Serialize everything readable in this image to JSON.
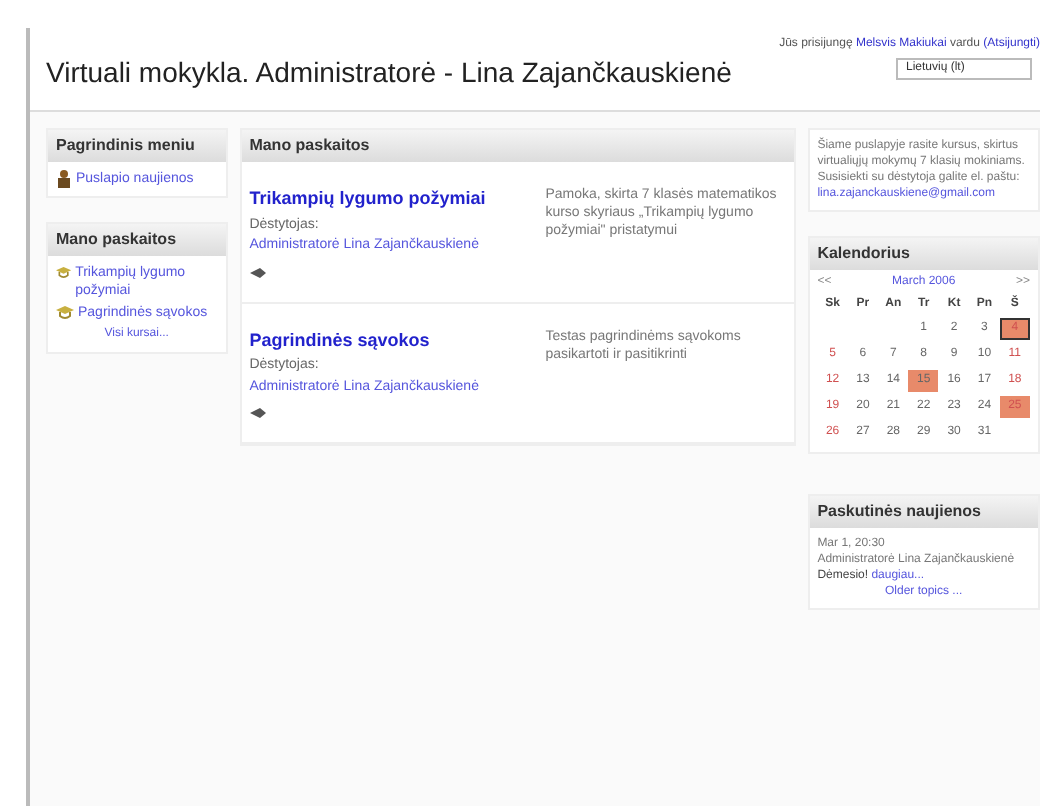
{
  "header": {
    "title": "Virtuali mokykla. Administratorė - Lina Zajančkauskienė",
    "login_prefix": "Jūs prisijungę",
    "login_user": "Melsvis Makiukai",
    "login_suffix": "vardu",
    "login_link": "(Atsijungti)",
    "language": "Lietuvių (lt)"
  },
  "left_blocks": [
    {
      "title": "Pagrindinis meniu",
      "items": [
        {
          "kind": "news",
          "label": "Puslapio naujienos"
        }
      ]
    },
    {
      "title": "Mano paskaitos",
      "items": [
        {
          "kind": "course",
          "label": "Trikampių lygumo požymiai"
        },
        {
          "kind": "course",
          "label": "Pagrindinės sąvokos"
        }
      ],
      "footer": "Visi kursai..."
    }
  ],
  "courses": {
    "title": "Mano paskaitos",
    "items": [
      {
        "name": "Trikampių lygumo požymiai",
        "teacher_label": "Dėstytojas:",
        "teacher": "Administratorė Lina Zajančkauskienė",
        "description": "Pamoka, skirta 7 klasės matematikos kurso skyriaus „Trikampių lygumo požymiai\" pristatymui"
      },
      {
        "name": "Pagrindinės sąvokos",
        "teacher_label": "Dėstytojas:",
        "teacher": "Administratorė Lina Zajančkauskienė",
        "description": "Testas pagrindinėms sąvokoms pasikartoti ir pasitikrinti"
      }
    ]
  },
  "info": {
    "text": "Šiame puslapyje rasite kursus, skirtus virtualiųjų mokymų 7 klasių mokiniams. Susisiekti su dėstytoja galite el. paštu:",
    "email": "lina.zajanckauskiene@gmail.com"
  },
  "calendar": {
    "title": "Kalendorius",
    "prev": "<<",
    "month": "March 2006",
    "next": ">>",
    "weekdays": [
      "Sk",
      "Pr",
      "An",
      "Tr",
      "Kt",
      "Pn",
      "Š"
    ],
    "weeks": [
      [
        {
          "day": "1",
          "event": false,
          "today": false
        },
        {
          "day": "2",
          "event": false,
          "today": false
        },
        {
          "day": "3",
          "event": false,
          "today": false
        },
        {
          "day": "4",
          "event": false,
          "today": true
        }
      ],
      [
        {
          "day": "5",
          "event": false,
          "today": false
        },
        {
          "day": "6",
          "event": false,
          "today": false
        },
        {
          "day": "7",
          "event": false,
          "today": false
        },
        {
          "day": "8",
          "event": false,
          "today": false
        },
        {
          "day": "9",
          "event": false,
          "today": false
        },
        {
          "day": "10",
          "event": false,
          "today": false
        },
        {
          "day": "11",
          "event": false,
          "today": false
        }
      ],
      [
        {
          "day": "12",
          "event": false,
          "today": false
        },
        {
          "day": "13",
          "event": false,
          "today": false
        },
        {
          "day": "14",
          "event": false,
          "today": false
        },
        {
          "day": "15",
          "event": true,
          "today": false
        },
        {
          "day": "16",
          "event": false,
          "today": false
        },
        {
          "day": "17",
          "event": false,
          "today": false
        },
        {
          "day": "18",
          "event": false,
          "today": false
        }
      ],
      [
        {
          "day": "19",
          "event": false,
          "today": false
        },
        {
          "day": "20",
          "event": false,
          "today": false
        },
        {
          "day": "21",
          "event": false,
          "today": false
        },
        {
          "day": "22",
          "event": false,
          "today": false
        },
        {
          "day": "23",
          "event": false,
          "today": false
        },
        {
          "day": "24",
          "event": false,
          "today": false
        },
        {
          "day": "25",
          "event": true,
          "today": false
        }
      ],
      [
        {
          "day": "26",
          "event": false,
          "today": false
        },
        {
          "day": "27",
          "event": false,
          "today": false
        },
        {
          "day": "28",
          "event": false,
          "today": false
        },
        {
          "day": "29",
          "event": false,
          "today": false
        },
        {
          "day": "30",
          "event": false,
          "today": false
        },
        {
          "day": "31",
          "event": false,
          "today": false
        }
      ]
    ]
  },
  "news": {
    "title": "Paskutinės naujienos",
    "date": "Mar 1, 20:30",
    "author": "Administratorė Lina Zajančkauskienė",
    "headline": "Dėmesio!",
    "more": "daugiau...",
    "older": "Older topics ..."
  }
}
